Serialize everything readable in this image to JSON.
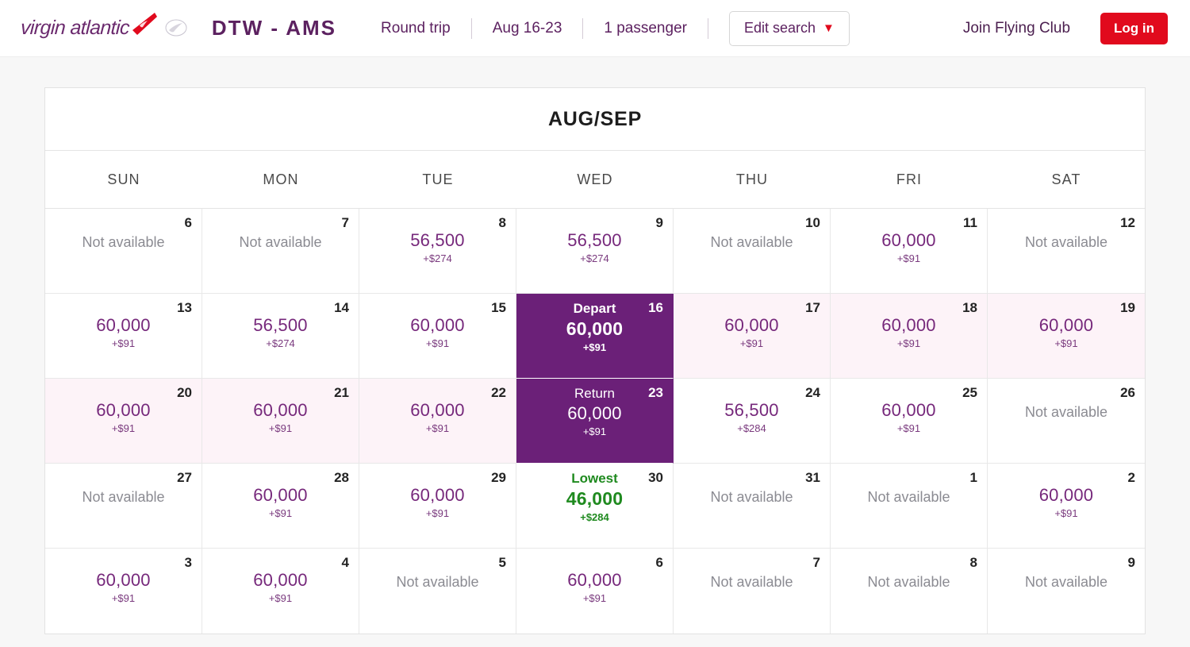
{
  "header": {
    "logo_text": "virgin atlantic",
    "logo_flag_icon": "virgin-flag-icon",
    "logo_emblem_icon": "virgin-roundel-icon",
    "route": "DTW - AMS",
    "trip_type": "Round trip",
    "dates": "Aug 16-23",
    "passengers": "1 passenger",
    "edit_search": "Edit search",
    "edit_search_icon": "chevron-down-icon",
    "join_link": "Join Flying Club",
    "login_button": "Log in"
  },
  "colors": {
    "brand_purple": "#6b2a6e",
    "selected_purple": "#6b2078",
    "range_pink": "#fdf3f8",
    "accent_red": "#e10a1d",
    "lowest_green": "#1f8a1f",
    "miles_purple": "#76287b"
  },
  "calendar": {
    "month_title": "AUG/SEP",
    "day_headers": [
      "SUN",
      "MON",
      "TUE",
      "WED",
      "THU",
      "FRI",
      "SAT"
    ],
    "unavailable_label": "Not available",
    "depart_label": "Depart",
    "return_label": "Return",
    "lowest_label": "Lowest",
    "cells": [
      {
        "day": "6",
        "available": false,
        "miles": "",
        "cash": "",
        "tag": "",
        "state": "none"
      },
      {
        "day": "7",
        "available": false,
        "miles": "",
        "cash": "",
        "tag": "",
        "state": "none"
      },
      {
        "day": "8",
        "available": true,
        "miles": "56,500",
        "cash": "+$274",
        "tag": "",
        "state": "none"
      },
      {
        "day": "9",
        "available": true,
        "miles": "56,500",
        "cash": "+$274",
        "tag": "",
        "state": "none"
      },
      {
        "day": "10",
        "available": false,
        "miles": "",
        "cash": "",
        "tag": "",
        "state": "none"
      },
      {
        "day": "11",
        "available": true,
        "miles": "60,000",
        "cash": "+$91",
        "tag": "",
        "state": "none"
      },
      {
        "day": "12",
        "available": false,
        "miles": "",
        "cash": "",
        "tag": "",
        "state": "none"
      },
      {
        "day": "13",
        "available": true,
        "miles": "60,000",
        "cash": "+$91",
        "tag": "",
        "state": "none"
      },
      {
        "day": "14",
        "available": true,
        "miles": "56,500",
        "cash": "+$274",
        "tag": "",
        "state": "none"
      },
      {
        "day": "15",
        "available": true,
        "miles": "60,000",
        "cash": "+$91",
        "tag": "",
        "state": "none"
      },
      {
        "day": "16",
        "available": true,
        "miles": "60,000",
        "cash": "+$91",
        "tag": "Depart",
        "state": "depart"
      },
      {
        "day": "17",
        "available": true,
        "miles": "60,000",
        "cash": "+$91",
        "tag": "",
        "state": "range"
      },
      {
        "day": "18",
        "available": true,
        "miles": "60,000",
        "cash": "+$91",
        "tag": "",
        "state": "range"
      },
      {
        "day": "19",
        "available": true,
        "miles": "60,000",
        "cash": "+$91",
        "tag": "",
        "state": "range"
      },
      {
        "day": "20",
        "available": true,
        "miles": "60,000",
        "cash": "+$91",
        "tag": "",
        "state": "range"
      },
      {
        "day": "21",
        "available": true,
        "miles": "60,000",
        "cash": "+$91",
        "tag": "",
        "state": "range"
      },
      {
        "day": "22",
        "available": true,
        "miles": "60,000",
        "cash": "+$91",
        "tag": "",
        "state": "range"
      },
      {
        "day": "23",
        "available": true,
        "miles": "60,000",
        "cash": "+$91",
        "tag": "Return",
        "state": "return"
      },
      {
        "day": "24",
        "available": true,
        "miles": "56,500",
        "cash": "+$284",
        "tag": "",
        "state": "none"
      },
      {
        "day": "25",
        "available": true,
        "miles": "60,000",
        "cash": "+$91",
        "tag": "",
        "state": "none"
      },
      {
        "day": "26",
        "available": false,
        "miles": "",
        "cash": "",
        "tag": "",
        "state": "none"
      },
      {
        "day": "27",
        "available": false,
        "miles": "",
        "cash": "",
        "tag": "",
        "state": "none"
      },
      {
        "day": "28",
        "available": true,
        "miles": "60,000",
        "cash": "+$91",
        "tag": "",
        "state": "none"
      },
      {
        "day": "29",
        "available": true,
        "miles": "60,000",
        "cash": "+$91",
        "tag": "",
        "state": "none"
      },
      {
        "day": "30",
        "available": true,
        "miles": "46,000",
        "cash": "+$284",
        "tag": "Lowest",
        "state": "lowest"
      },
      {
        "day": "31",
        "available": false,
        "miles": "",
        "cash": "",
        "tag": "",
        "state": "none"
      },
      {
        "day": "1",
        "available": false,
        "miles": "",
        "cash": "",
        "tag": "",
        "state": "none"
      },
      {
        "day": "2",
        "available": true,
        "miles": "60,000",
        "cash": "+$91",
        "tag": "",
        "state": "none"
      },
      {
        "day": "3",
        "available": true,
        "miles": "60,000",
        "cash": "+$91",
        "tag": "",
        "state": "none"
      },
      {
        "day": "4",
        "available": true,
        "miles": "60,000",
        "cash": "+$91",
        "tag": "",
        "state": "none"
      },
      {
        "day": "5",
        "available": false,
        "miles": "",
        "cash": "",
        "tag": "",
        "state": "none"
      },
      {
        "day": "6",
        "available": true,
        "miles": "60,000",
        "cash": "+$91",
        "tag": "",
        "state": "none"
      },
      {
        "day": "7",
        "available": false,
        "miles": "",
        "cash": "",
        "tag": "",
        "state": "none"
      },
      {
        "day": "8",
        "available": false,
        "miles": "",
        "cash": "",
        "tag": "",
        "state": "none"
      },
      {
        "day": "9",
        "available": false,
        "miles": "",
        "cash": "",
        "tag": "",
        "state": "none"
      }
    ]
  }
}
